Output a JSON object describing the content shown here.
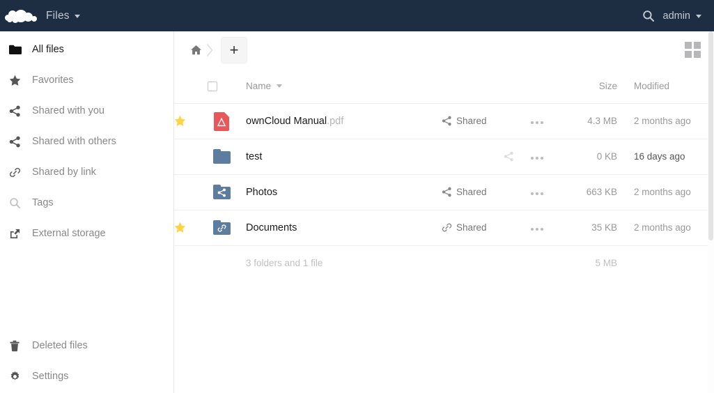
{
  "header": {
    "logo_icon": "owncloud-cloud-logo",
    "app_name": "Files",
    "app_caret_icon": "chevron-down-icon",
    "search_icon": "search-icon",
    "user_name": "admin",
    "user_caret_icon": "chevron-down-icon",
    "background_color": "#1d2d42",
    "text_color": "#c3c9d2"
  },
  "sidebar": {
    "top_items": [
      {
        "label": "All files",
        "icon": "folder-icon",
        "active": true
      },
      {
        "label": "Favorites",
        "icon": "star-icon",
        "active": false
      },
      {
        "label": "Shared with you",
        "icon": "share-icon",
        "active": false
      },
      {
        "label": "Shared with others",
        "icon": "share-icon",
        "active": false
      },
      {
        "label": "Shared by link",
        "icon": "link-icon",
        "active": false
      },
      {
        "label": "Tags",
        "icon": "search-icon",
        "active": false
      },
      {
        "label": "External storage",
        "icon": "external-link-icon",
        "active": false
      }
    ],
    "bottom_items": [
      {
        "label": "Deleted files",
        "icon": "trash-icon"
      },
      {
        "label": "Settings",
        "icon": "gear-icon"
      }
    ]
  },
  "controls": {
    "home_icon": "home-icon",
    "separator_icon": "chevron-right-icon",
    "new_button_label": "+",
    "new_button_icon": "plus-icon",
    "view_toggle_icon": "grid-view-icon"
  },
  "table": {
    "select_all_icon": "checkbox-icon",
    "columns": {
      "name": "Name",
      "size": "Size",
      "modified": "Modified"
    },
    "sort_caret_icon": "caret-down-icon",
    "actions_icon": "ellipsis-icon",
    "rows": [
      {
        "starred": true,
        "icon": "pdf-file-icon",
        "icon_type": "pdf",
        "name_base": "ownCloud Manual",
        "name_ext": ".pdf",
        "share_icon": "share-icon",
        "share_label": "Shared",
        "share_state": "shared",
        "size": "4.3 MB",
        "modified": "2 months ago",
        "modified_recent": false
      },
      {
        "starred": false,
        "icon": "folder-icon",
        "icon_type": "folder",
        "name_base": "test",
        "name_ext": "",
        "share_icon": "share-icon",
        "share_label": "",
        "share_state": "unshared",
        "size": "0 KB",
        "modified": "16 days ago",
        "modified_recent": true
      },
      {
        "starred": false,
        "icon": "shared-folder-icon",
        "icon_type": "folder-share",
        "name_base": "Photos",
        "name_ext": "",
        "share_icon": "share-icon",
        "share_label": "Shared",
        "share_state": "shared",
        "size": "663 KB",
        "modified": "2 months ago",
        "modified_recent": false
      },
      {
        "starred": true,
        "icon": "link-folder-icon",
        "icon_type": "folder-link",
        "name_base": "Documents",
        "name_ext": "",
        "share_icon": "link-icon",
        "share_label": "Shared",
        "share_state": "shared-link",
        "size": "35 KB",
        "modified": "2 months ago",
        "modified_recent": false
      }
    ],
    "summary": {
      "count_text": "3 folders and 1 file",
      "total_size": "5 MB"
    }
  },
  "colors": {
    "folder_blue": "#5d7d9e",
    "pdf_red": "#e8575b",
    "star_gold": "#ffd347",
    "muted_text": "#999999"
  }
}
